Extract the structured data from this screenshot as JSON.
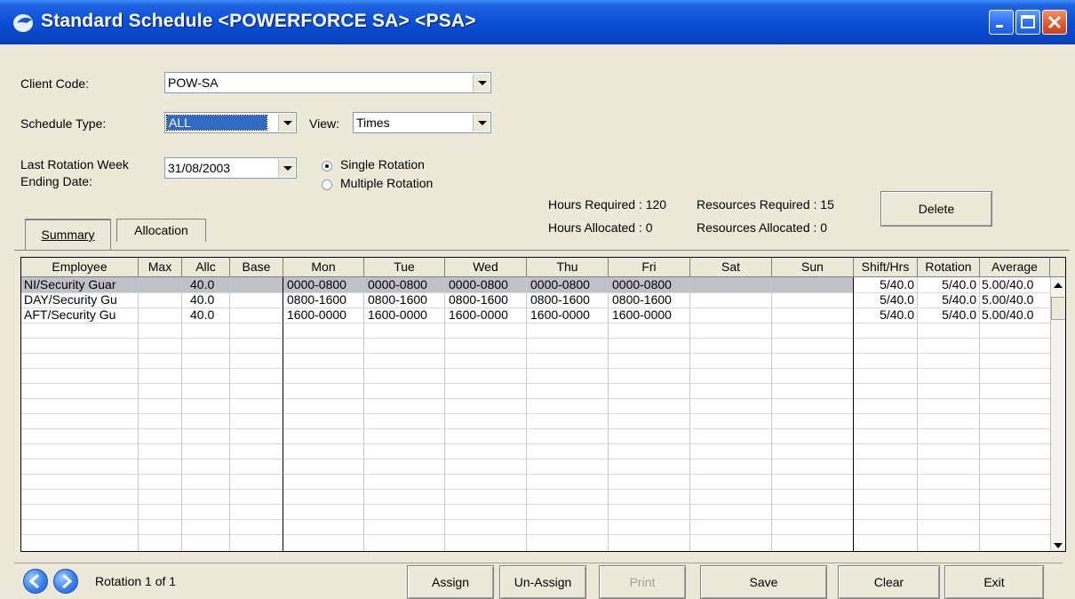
{
  "window": {
    "title": "Standard Schedule <POWERFORCE SA> <PSA>"
  },
  "form": {
    "client_code_label": "Client Code:",
    "client_code_value": "POW-SA",
    "schedule_type_label": "Schedule Type:",
    "schedule_type_value": "ALL",
    "view_label": "View:",
    "view_value": "Times",
    "last_rotation_label_1": "Last Rotation Week",
    "last_rotation_label_2": "Ending Date:",
    "last_rotation_value": "31/08/2003",
    "rotation_single": "Single Rotation",
    "rotation_multiple": "Multiple Rotation",
    "rotation_selected": "Single Rotation"
  },
  "stats": {
    "hours_required": "Hours Required : 120",
    "hours_allocated": "Hours Allocated : 0",
    "resources_required": "Resources  Required : 15",
    "resources_allocated": "Resources  Allocated : 0"
  },
  "buttons": {
    "delete": "Delete"
  },
  "tabs": [
    {
      "label": "Summary",
      "active": true
    },
    {
      "label": "Allocation",
      "active": false
    }
  ],
  "grid": {
    "columns": [
      "Employee",
      "Max",
      "Allc",
      "Base",
      "Mon",
      "Tue",
      "Wed",
      "Thu",
      "Fri",
      "Sat",
      "Sun",
      "Shift/Hrs",
      "Rotation",
      "Average"
    ],
    "rows": [
      {
        "employee": "NI/Security Guar",
        "max": "",
        "allc": "40.0",
        "base": "",
        "mon": "0000-0800",
        "tue": "0000-0800",
        "wed": "0000-0800",
        "thu": "0000-0800",
        "fri": "0000-0800",
        "sat": "",
        "sun": "",
        "shift": "5/40.0",
        "rotation": "5/40.0",
        "average": "5.00/40.0"
      },
      {
        "employee": "DAY/Security Gu",
        "max": "",
        "allc": "40.0",
        "base": "",
        "mon": "0800-1600",
        "tue": "0800-1600",
        "wed": "0800-1600",
        "thu": "0800-1600",
        "fri": "0800-1600",
        "sat": "",
        "sun": "",
        "shift": "5/40.0",
        "rotation": "5/40.0",
        "average": "5.00/40.0"
      },
      {
        "employee": "AFT/Security Gu",
        "max": "",
        "allc": "40.0",
        "base": "",
        "mon": "1600-0000",
        "tue": "1600-0000",
        "wed": "1600-0000",
        "thu": "1600-0000",
        "fri": "1600-0000",
        "sat": "",
        "sun": "",
        "shift": "5/40.0",
        "rotation": "5/40.0",
        "average": "5.00/40.0"
      }
    ]
  },
  "footer": {
    "rotation_text": "Rotation 1 of 1",
    "assign": "Assign",
    "unassign": "Un-Assign",
    "print": "Print",
    "save": "Save",
    "clear": "Clear",
    "exit": "Exit"
  },
  "colors": {
    "titlebar": "#0a4fd6",
    "selection": "#316ac5",
    "selected_row": "#c0c0c8",
    "window_bg": "#ece9d8"
  }
}
